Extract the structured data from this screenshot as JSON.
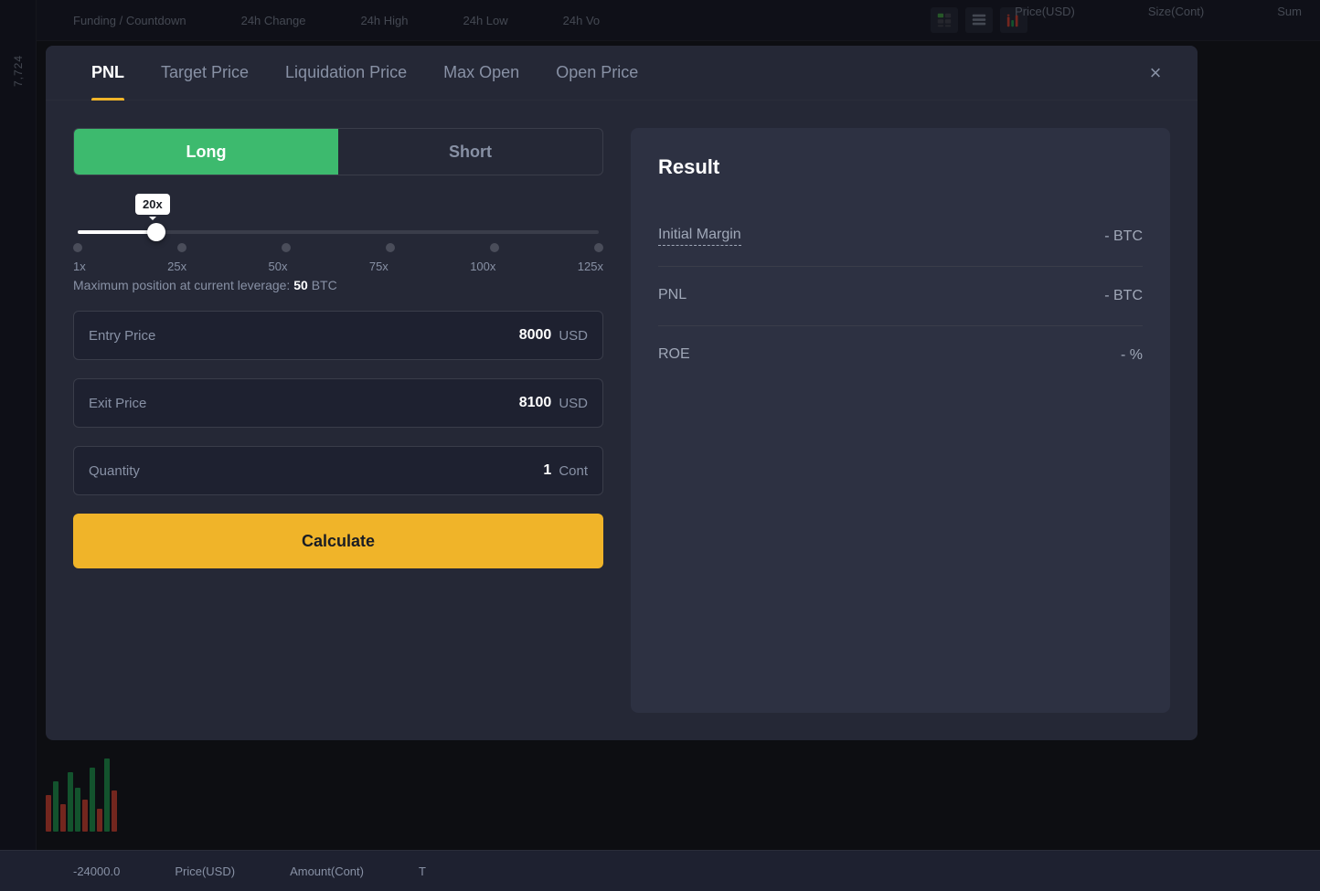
{
  "topBar": {
    "items": [
      "Funding / Countdown",
      "24h Change",
      "24h High",
      "24h Low",
      "24h Vo"
    ]
  },
  "bottomBar": {
    "price_negative": "-24000.0",
    "col1": "Price(USD)",
    "col2": "Amount(Cont)",
    "col3": "T"
  },
  "priceHeaders": {
    "col1": "Price(USD)",
    "col2": "Size(Cont)",
    "col3": "Sum"
  },
  "modal": {
    "tabs": [
      {
        "id": "pnl",
        "label": "PNL",
        "active": true
      },
      {
        "id": "target-price",
        "label": "Target Price",
        "active": false
      },
      {
        "id": "liquidation-price",
        "label": "Liquidation Price",
        "active": false
      },
      {
        "id": "max-open",
        "label": "Max Open",
        "active": false
      },
      {
        "id": "open-price",
        "label": "Open Price",
        "active": false
      }
    ],
    "close_label": "×"
  },
  "calculator": {
    "toggle": {
      "long_label": "Long",
      "short_label": "Short"
    },
    "leverage": {
      "current": "20x",
      "markers": [
        "1x",
        "25x",
        "50x",
        "75x",
        "100x",
        "125x"
      ]
    },
    "max_position_text": "Maximum position at current leverage:",
    "max_position_value": "50",
    "max_position_unit": "BTC",
    "entry_price": {
      "label": "Entry Price",
      "value": "8000",
      "unit": "USD"
    },
    "exit_price": {
      "label": "Exit Price",
      "value": "8100",
      "unit": "USD"
    },
    "quantity": {
      "label": "Quantity",
      "value": "1",
      "unit": "Cont"
    },
    "calculate_btn": "Calculate"
  },
  "result": {
    "title": "Result",
    "rows": [
      {
        "label": "Initial Margin",
        "value": "- BTC",
        "underline": true
      },
      {
        "label": "PNL",
        "value": "- BTC",
        "underline": false
      },
      {
        "label": "ROE",
        "value": "- %",
        "underline": false
      }
    ]
  },
  "bgPrice": "7,724"
}
